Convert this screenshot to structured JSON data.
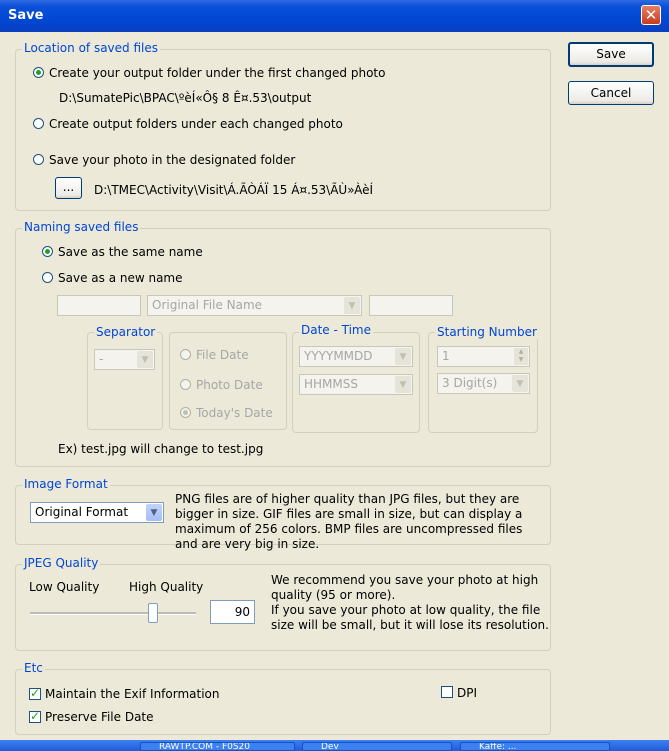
{
  "window": {
    "title": "Save",
    "close_glyph": "✕"
  },
  "buttons": {
    "save": "Save",
    "cancel": "Cancel"
  },
  "location": {
    "legend": "Location of saved files",
    "opt_first": "Create your output folder under the first changed photo",
    "first_path": "D:\\SumatePic\\BPAC\\ºèÍ«Ô§ 8 Ê¤.53\\output",
    "opt_each": "Create output folders under each changed photo",
    "opt_designated": "Save your photo in the designated folder",
    "browse_label": "...",
    "designated_path": "D:\\TMEC\\Activity\\Visit\\Á.ÃÒÁÏ 15 Á¤.53\\ÃÙ»ÀèÍ"
  },
  "naming": {
    "legend": "Naming saved files",
    "opt_same": "Save as the same name",
    "opt_new": "Save as a new name",
    "prefix_value": "",
    "name_value": "Original File Name",
    "suffix_value": "",
    "separator_legend": "Separator",
    "separator_value": "-",
    "file_date": "File Date",
    "photo_date": "Photo Date",
    "todays_date": "Today's Date",
    "datetime_legend": "Date - Time",
    "date_format": "YYYYMMDD",
    "time_format": "HHMMSS",
    "starting_legend": "Starting Number",
    "start_value": "1",
    "digits_value": "3 Digit(s)",
    "example": "Ex) test.jpg will change to test.jpg"
  },
  "format": {
    "legend": "Image Format",
    "value": "Original Format",
    "description": "PNG files are of higher quality than JPG files, but they are bigger in size. GIF files are small in size, but can display a maximum of 256 colors. BMP files are uncompressed files and are very big in size."
  },
  "jpeg": {
    "legend": "JPEG Quality",
    "low": "Low Quality",
    "high": "High Quality",
    "value": "90",
    "slider_fraction": 0.74,
    "description": "We recommend you save your photo at high quality (95 or more).\nIf you save your photo at low quality, the file size will be small, but it will lose its resolution."
  },
  "etc": {
    "legend": "Etc",
    "exif": "Maintain the Exif Information",
    "preserve": "Preserve File Date",
    "dpi": "DPI"
  },
  "taskbar": {
    "items": [
      "RAWTP.COM - F0S20",
      "Dev",
      "Kaffe: ..."
    ]
  },
  "colors": {
    "accent": "#0046d5",
    "titlebar": "#0a50d8",
    "background": "#ece9d8"
  }
}
